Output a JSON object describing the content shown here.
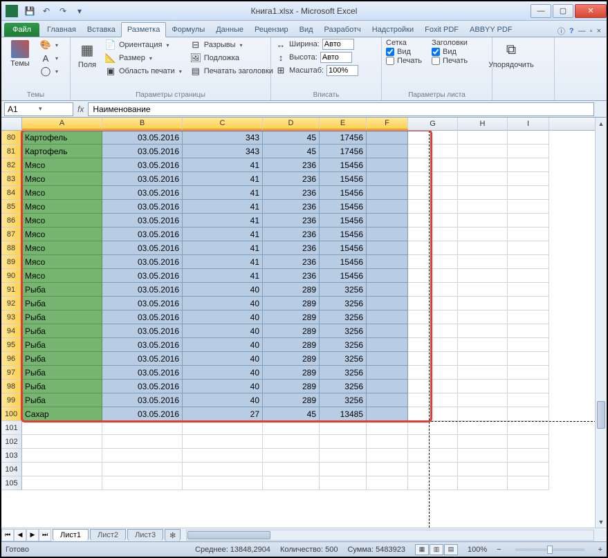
{
  "title": "Книга1.xlsx - Microsoft Excel",
  "tabs": {
    "file": "Файл",
    "list": [
      "Главная",
      "Вставка",
      "Разметка",
      "Формулы",
      "Данные",
      "Рецензир",
      "Вид",
      "Разработч",
      "Надстройки",
      "Foxit PDF",
      "ABBYY PDF"
    ],
    "active_index": 2
  },
  "ribbon": {
    "themes": {
      "big": "Темы",
      "group": "Темы"
    },
    "page_setup": {
      "big": "Поля",
      "orientation": "Ориентация",
      "size": "Размер",
      "print_area": "Область печати",
      "breaks": "Разрывы",
      "background": "Подложка",
      "print_titles": "Печатать заголовки",
      "group": "Параметры страницы"
    },
    "fit": {
      "width_lbl": "Ширина:",
      "width_val": "Авто",
      "height_lbl": "Высота:",
      "height_val": "Авто",
      "scale_lbl": "Масштаб:",
      "scale_val": "100%",
      "group": "Вписать"
    },
    "sheet_opts": {
      "grid_hdr": "Сетка",
      "titles_hdr": "Заголовки",
      "view_lbl": "Вид",
      "print_lbl": "Печать",
      "group": "Параметры листа"
    },
    "arrange": {
      "big": "Упорядочить",
      "group": ""
    }
  },
  "namebox": "A1",
  "formula": "Наименование",
  "columns": [
    "A",
    "B",
    "C",
    "D",
    "E",
    "F",
    "G",
    "H",
    "I"
  ],
  "rows": [
    {
      "n": 80,
      "a": "Картофель",
      "b": "03.05.2016",
      "c": "343",
      "d": "45",
      "e": "17456"
    },
    {
      "n": 81,
      "a": "Картофель",
      "b": "03.05.2016",
      "c": "343",
      "d": "45",
      "e": "17456"
    },
    {
      "n": 82,
      "a": "Мясо",
      "b": "03.05.2016",
      "c": "41",
      "d": "236",
      "e": "15456"
    },
    {
      "n": 83,
      "a": "Мясо",
      "b": "03.05.2016",
      "c": "41",
      "d": "236",
      "e": "15456"
    },
    {
      "n": 84,
      "a": "Мясо",
      "b": "03.05.2016",
      "c": "41",
      "d": "236",
      "e": "15456"
    },
    {
      "n": 85,
      "a": "Мясо",
      "b": "03.05.2016",
      "c": "41",
      "d": "236",
      "e": "15456"
    },
    {
      "n": 86,
      "a": "Мясо",
      "b": "03.05.2016",
      "c": "41",
      "d": "236",
      "e": "15456"
    },
    {
      "n": 87,
      "a": "Мясо",
      "b": "03.05.2016",
      "c": "41",
      "d": "236",
      "e": "15456"
    },
    {
      "n": 88,
      "a": "Мясо",
      "b": "03.05.2016",
      "c": "41",
      "d": "236",
      "e": "15456"
    },
    {
      "n": 89,
      "a": "Мясо",
      "b": "03.05.2016",
      "c": "41",
      "d": "236",
      "e": "15456"
    },
    {
      "n": 90,
      "a": "Мясо",
      "b": "03.05.2016",
      "c": "41",
      "d": "236",
      "e": "15456"
    },
    {
      "n": 91,
      "a": "Рыба",
      "b": "03.05.2016",
      "c": "40",
      "d": "289",
      "e": "3256"
    },
    {
      "n": 92,
      "a": "Рыба",
      "b": "03.05.2016",
      "c": "40",
      "d": "289",
      "e": "3256"
    },
    {
      "n": 93,
      "a": "Рыба",
      "b": "03.05.2016",
      "c": "40",
      "d": "289",
      "e": "3256"
    },
    {
      "n": 94,
      "a": "Рыба",
      "b": "03.05.2016",
      "c": "40",
      "d": "289",
      "e": "3256"
    },
    {
      "n": 95,
      "a": "Рыба",
      "b": "03.05.2016",
      "c": "40",
      "d": "289",
      "e": "3256"
    },
    {
      "n": 96,
      "a": "Рыба",
      "b": "03.05.2016",
      "c": "40",
      "d": "289",
      "e": "3256"
    },
    {
      "n": 97,
      "a": "Рыба",
      "b": "03.05.2016",
      "c": "40",
      "d": "289",
      "e": "3256"
    },
    {
      "n": 98,
      "a": "Рыба",
      "b": "03.05.2016",
      "c": "40",
      "d": "289",
      "e": "3256"
    },
    {
      "n": 99,
      "a": "Рыба",
      "b": "03.05.2016",
      "c": "40",
      "d": "289",
      "e": "3256"
    },
    {
      "n": 100,
      "a": "Сахар",
      "b": "03.05.2016",
      "c": "27",
      "d": "45",
      "e": "13485"
    }
  ],
  "empty_rows": [
    101,
    102,
    103,
    104,
    105
  ],
  "sheets": [
    "Лист1",
    "Лист2",
    "Лист3"
  ],
  "status": {
    "ready": "Готово",
    "avg": "Среднее: 13848,2904",
    "count": "Количество: 500",
    "sum": "Сумма: 5483923",
    "zoom": "100%"
  }
}
